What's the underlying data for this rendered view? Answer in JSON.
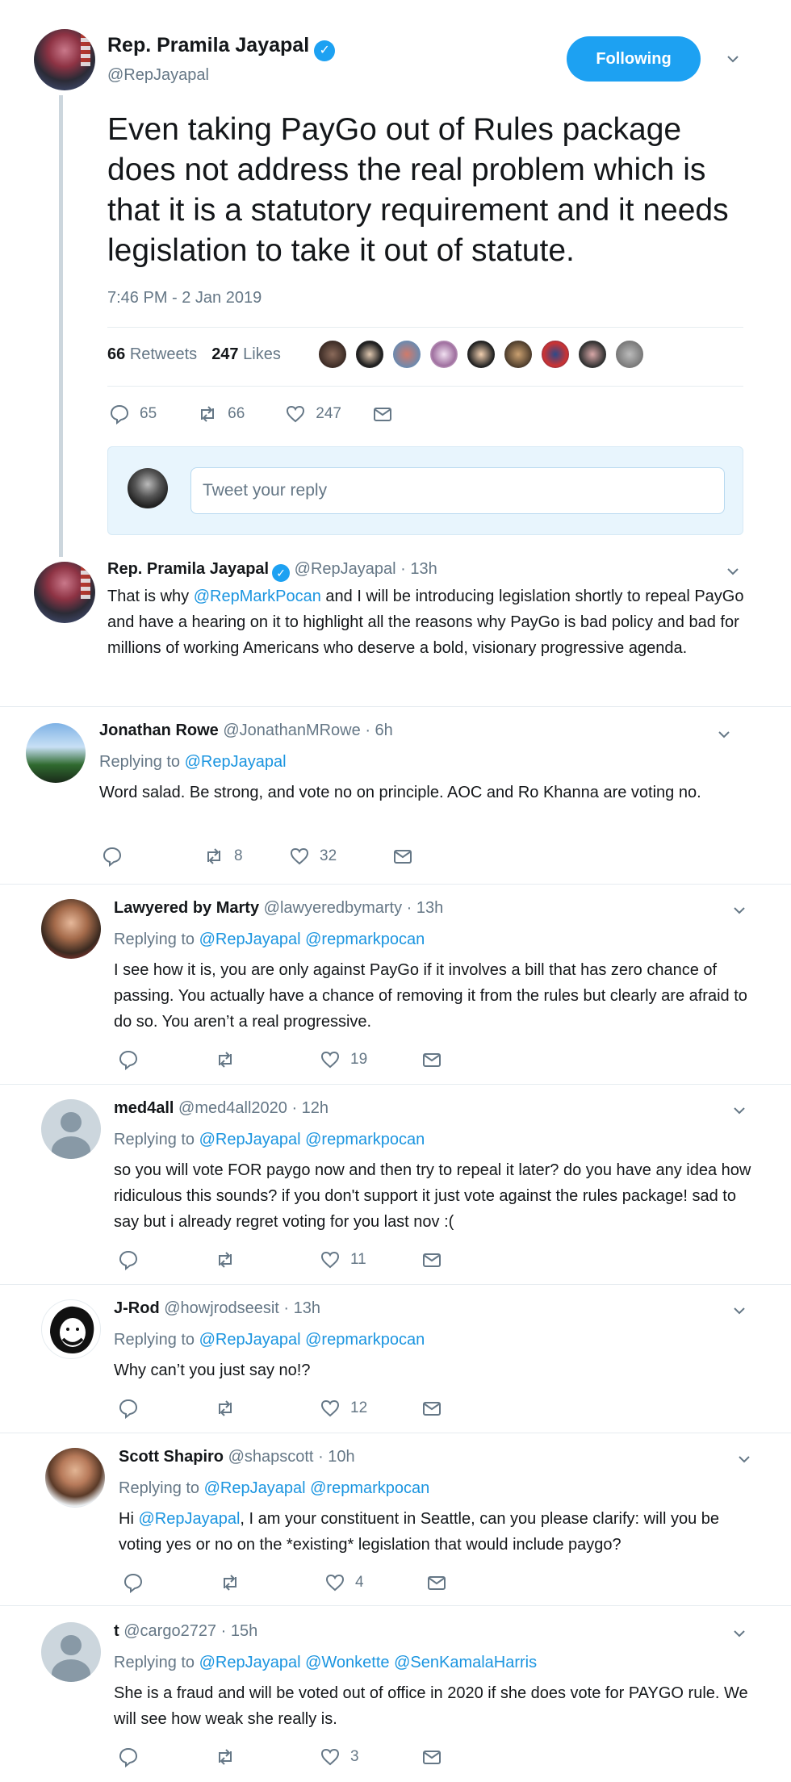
{
  "main_tweet": {
    "author_name": "Rep. Pramila Jayapal",
    "author_handle": "@RepJayapal",
    "follow_label": "Following",
    "text": "Even taking PayGo out of Rules package does not address the real problem which is that it is a statutory requirement and it needs legislation to take it out of statute.",
    "timestamp": "7:46 PM - 2 Jan 2019",
    "retweets": "66",
    "retweets_label": "Retweets",
    "likes": "247",
    "likes_label": "Likes",
    "likers_count": 9,
    "reply_count": "65",
    "retweet_count": "66",
    "like_count": "247",
    "reply_placeholder": "Tweet your reply"
  },
  "thread_reply": {
    "author_name": "Rep. Pramila Jayapal",
    "author_handle": "@RepJayapal",
    "time": "· 13h",
    "text_1": "That is why ",
    "mention": "@RepMarkPocan",
    "text_2": " and I will be introducing legislation shortly to repeal PayGo and have a hearing on it to highlight all the reasons why PayGo is bad policy and bad for millions of working Americans who deserve a bold, visionary progressive agenda."
  },
  "replies": [
    {
      "name": "Jonathan Rowe",
      "handle": "@JonathanMRowe",
      "time": "· 6h",
      "replying_label": "Replying to",
      "replying_to": "@RepJayapal",
      "text": "Word salad. Be strong, and vote no on principle. AOC and Ro Khanna are voting no.",
      "retweets": "8",
      "likes": "32"
    },
    {
      "name": "Lawyered by Marty",
      "handle": "@lawyeredbymarty",
      "time": "· 13h",
      "replying_label": "Replying to",
      "replying_to": "@RepJayapal @repmarkpocan",
      "text": "I see how it is, you are only against PayGo if it involves a bill that has zero chance of passing. You actually have a chance of removing it from the rules but clearly are afraid to do so. You aren’t a real progressive.",
      "likes": "19"
    },
    {
      "name": "med4all",
      "handle": "@med4all2020",
      "time": "· 12h",
      "replying_label": "Replying to",
      "replying_to": "@RepJayapal @repmarkpocan",
      "text": "so you will vote FOR paygo now and then try to repeal it later? do you have any idea how ridiculous this sounds? if you don't support it just vote against the rules package! sad to say but i already regret voting for you last nov :(",
      "likes": "11"
    },
    {
      "name": "J-Rod",
      "handle": "@howjrodseesit",
      "time": "· 13h",
      "replying_label": "Replying to",
      "replying_to": "@RepJayapal @repmarkpocan",
      "text": "Why can’t you just say no!?",
      "likes": "12"
    },
    {
      "name": "Scott Shapiro",
      "handle": "@shapscott",
      "time": "· 10h",
      "replying_label": "Replying to",
      "replying_to": "@RepJayapal @repmarkpocan",
      "text_1": "Hi ",
      "mention": "@RepJayapal",
      "text_2": ", I am your constituent  in Seattle, can you please clarify: will you be voting yes or no on the *existing* legislation that would include paygo?",
      "likes": "4"
    },
    {
      "name": "t",
      "handle": "@cargo2727",
      "time": "· 15h",
      "replying_label": "Replying to",
      "replying_to": "@RepJayapal @Wonkette @SenKamalaHarris",
      "text": "She is a fraud and will be voted out of office in 2020 if she does vote for PAYGO rule. We will see how weak she really is.",
      "likes": "3"
    }
  ],
  "colors": {
    "accent": "#1da1f2",
    "link": "#1b95e0",
    "muted": "#657786",
    "reply_box_bg": "#e8f5fd"
  }
}
